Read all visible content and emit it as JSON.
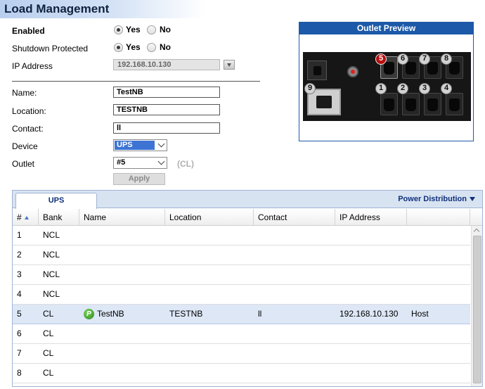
{
  "header": {
    "title": "Load Management"
  },
  "form": {
    "enabled": {
      "label": "Enabled",
      "yes": "Yes",
      "no": "No",
      "value": "Yes"
    },
    "shutdown_protected": {
      "label": "Shutdown Protected",
      "yes": "Yes",
      "no": "No",
      "value": "Yes"
    },
    "ip_address": {
      "label": "IP Address",
      "value": "192.168.10.130"
    },
    "name": {
      "label": "Name:",
      "value": "TestNB"
    },
    "location": {
      "label": "Location:",
      "value": "TESTNB"
    },
    "contact": {
      "label": "Contact:",
      "value": "ll"
    },
    "device": {
      "label": "Device",
      "value": "UPS"
    },
    "outlet": {
      "label": "Outlet",
      "value": "#5",
      "bank_hint": "(CL)"
    },
    "apply_label": "Apply"
  },
  "outlet_preview": {
    "title": "Outlet Preview",
    "selected_outlet": "5",
    "outlet_numbers_top": [
      "5",
      "6",
      "7",
      "8"
    ],
    "outlet_numbers_bottom": [
      "1",
      "2",
      "3",
      "4"
    ],
    "large_outlet_number": "9",
    "selected_color": "#b80e0e"
  },
  "grid": {
    "tabs": [
      "UPS"
    ],
    "power_distribution_label": "Power Distribution",
    "columns": [
      "#",
      "Bank",
      "Name",
      "Location",
      "Contact",
      "IP Address"
    ],
    "rows": [
      {
        "num": "1",
        "bank": "NCL",
        "name": "",
        "location": "",
        "contact": "",
        "ip": "",
        "extra": ""
      },
      {
        "num": "2",
        "bank": "NCL",
        "name": "",
        "location": "",
        "contact": "",
        "ip": "",
        "extra": ""
      },
      {
        "num": "3",
        "bank": "NCL",
        "name": "",
        "location": "",
        "contact": "",
        "ip": "",
        "extra": ""
      },
      {
        "num": "4",
        "bank": "NCL",
        "name": "",
        "location": "",
        "contact": "",
        "ip": "",
        "extra": ""
      },
      {
        "num": "5",
        "bank": "CL",
        "name": "TestNB",
        "location": "TESTNB",
        "contact": "ll",
        "ip": "192.168.10.130",
        "extra": "Host"
      },
      {
        "num": "6",
        "bank": "CL",
        "name": "",
        "location": "",
        "contact": "",
        "ip": "",
        "extra": ""
      },
      {
        "num": "7",
        "bank": "CL",
        "name": "",
        "location": "",
        "contact": "",
        "ip": "",
        "extra": ""
      },
      {
        "num": "8",
        "bank": "CL",
        "name": "",
        "location": "",
        "contact": "",
        "ip": "",
        "extra": ""
      }
    ],
    "selected_row": "5",
    "host_icon_letter": "P"
  }
}
